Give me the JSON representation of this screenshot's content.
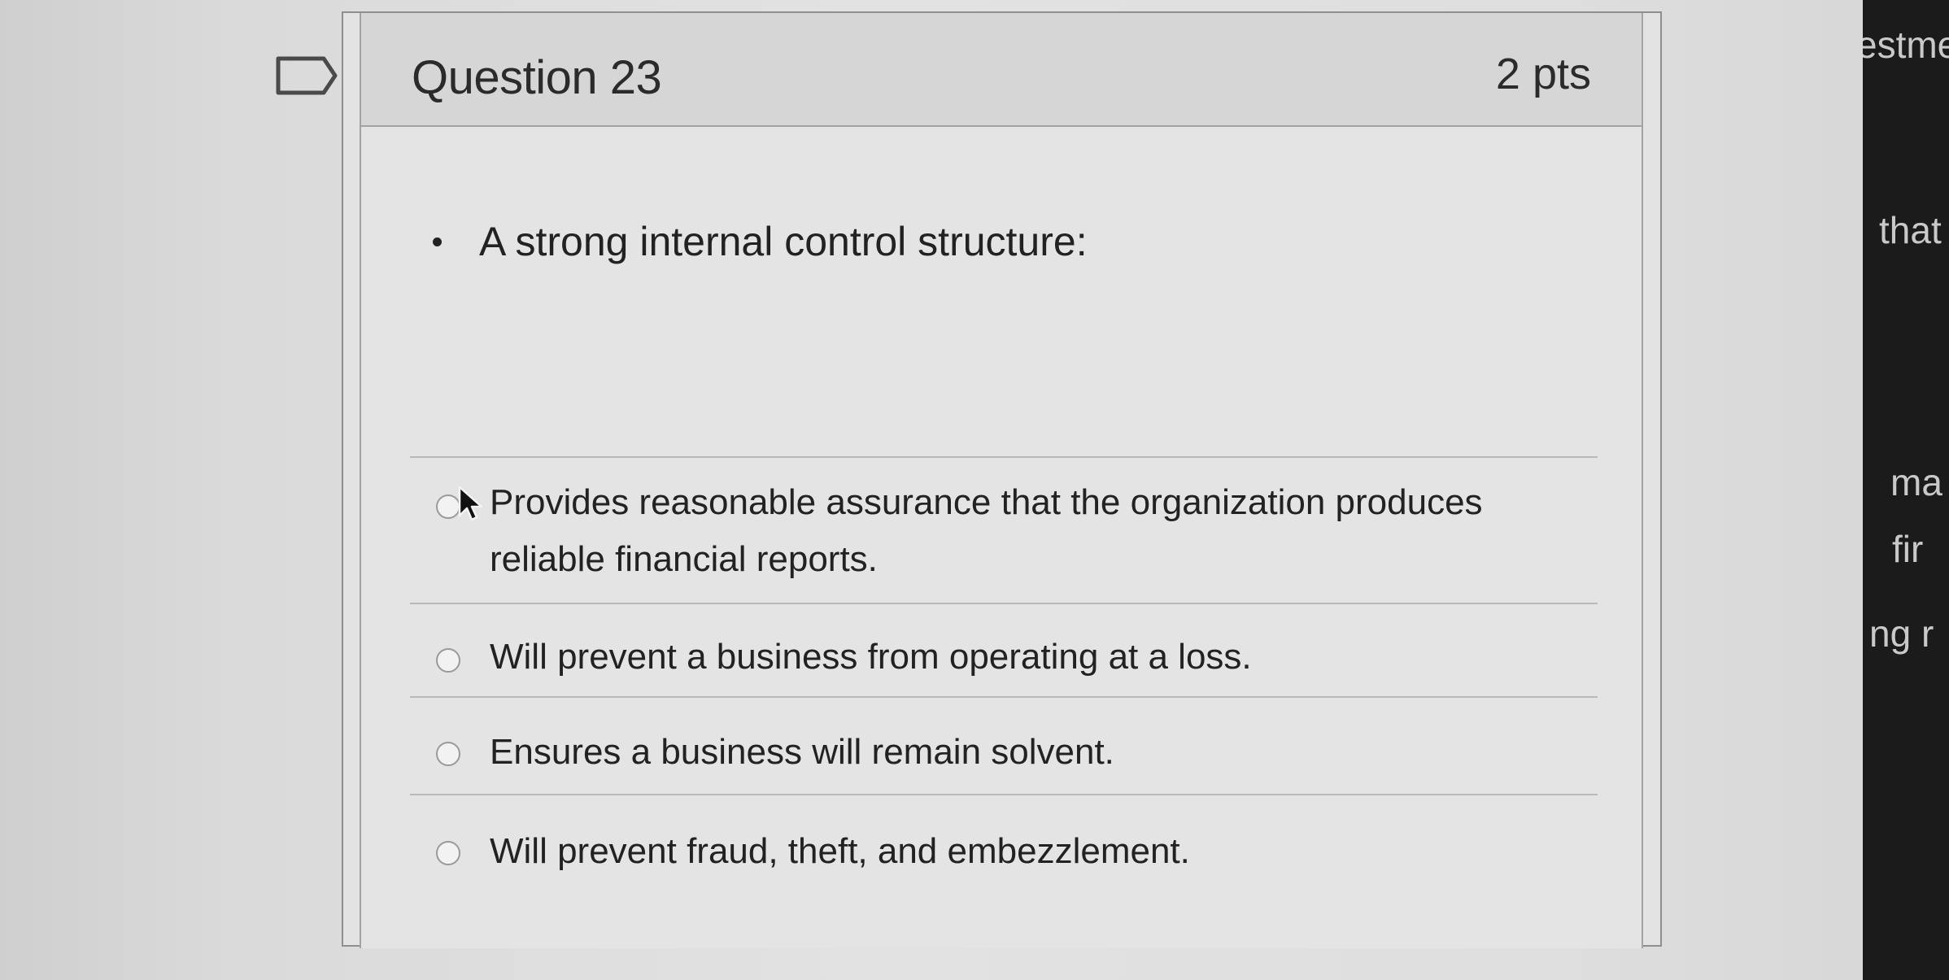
{
  "question": {
    "title": "Question 23",
    "points": "2 pts",
    "prompt": "A strong internal control structure:",
    "answers": [
      "Provides reasonable assurance that the organization produces reliable financial reports.",
      "Will prevent a business from operating at a loss.",
      "Ensures a business will remain solvent.",
      "Will prevent fraud, theft, and embezzlement."
    ]
  },
  "side_panel": {
    "fragments": [
      "estme",
      "that",
      "ma",
      "fir",
      "ng r"
    ]
  },
  "icons": {
    "flag": "bookmark-flag-icon",
    "cursor": "mouse-pointer-icon",
    "radio": "radio-button-icon"
  },
  "colors": {
    "card_background": "#e3e3e3",
    "header_background": "#d6d6d6",
    "text": "#222222",
    "side_panel": "#1b1b1b"
  }
}
